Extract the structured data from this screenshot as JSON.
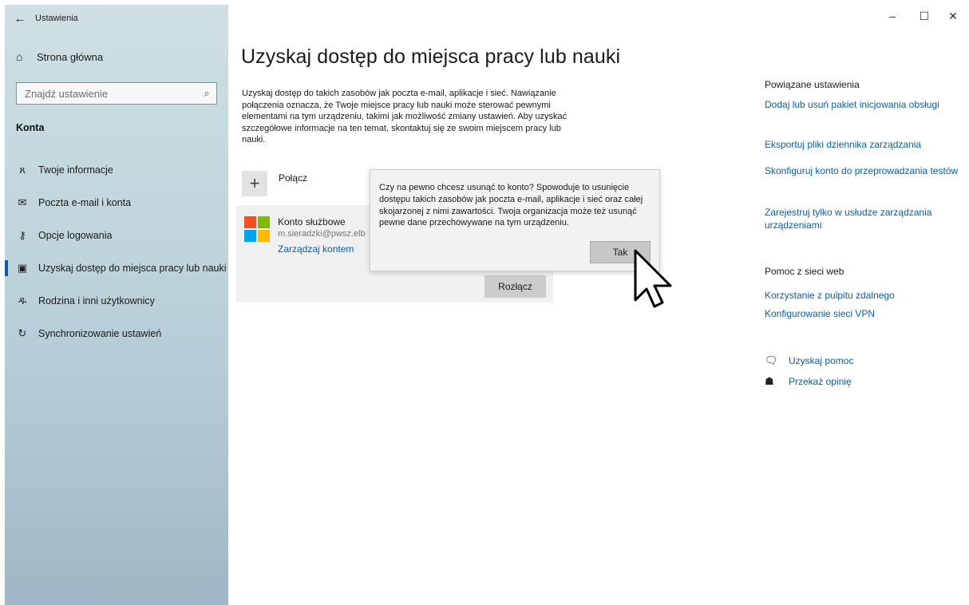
{
  "app": {
    "title": "Ustawienia"
  },
  "window_controls": {
    "minimize": "–",
    "maximize": "☐",
    "close": "✕"
  },
  "sidebar": {
    "home_label": "Strona główna",
    "search_placeholder": "Znajdź ustawienie",
    "section_title": "Konta",
    "items": [
      {
        "label": "Twoje informacje",
        "icon": "person-card-icon"
      },
      {
        "label": "Poczta e-mail i konta",
        "icon": "mail-icon"
      },
      {
        "label": "Opcje logowania",
        "icon": "key-icon"
      },
      {
        "label": "Uzyskaj dostęp do miejsca pracy lub nauki",
        "icon": "briefcase-icon",
        "active": true
      },
      {
        "label": "Rodzina i inni użytkownicy",
        "icon": "add-person-icon"
      },
      {
        "label": "Synchronizowanie ustawień",
        "icon": "sync-icon"
      }
    ]
  },
  "main": {
    "title": "Uzyskaj dostęp do miejsca pracy lub nauki",
    "intro": "Uzyskaj dostęp do takich zasobów jak poczta e-mail, aplikacje i sieć. Nawiązanie połączenia oznacza, że Twoje miejsce pracy lub nauki może sterować pewnymi elementami na tym urządzeniu, takimi jak możliwość zmiany ustawień. Aby uzyskać szczegółowe informacje na ten temat, skontaktuj się ze swoim miejscem pracy lub nauki.",
    "connect_label": "Połącz",
    "account": {
      "name": "Konto służbowe",
      "email": "m.sieradzki@pwsz.elb",
      "manage_label": "Zarządzaj kontem",
      "disconnect_label": "Rozłącz"
    }
  },
  "dialog": {
    "text": "Czy na pewno chcesz usunąć to konto? Spowoduje to usunięcie dostępu takich zasobów jak poczta e-mail, aplikacje i sieć oraz całej skojarzonej z nimi zawartości. Twoja organizacja może też usunąć pewne dane przechowywane na tym urządzeniu.",
    "yes_label": "Tak"
  },
  "right_panel": {
    "related_heading": "Powiązane ustawienia",
    "related_links": [
      "Dodaj lub usuń pakiet inicjowania obsługi",
      "Eksportuj pliki dziennika zarządzania",
      "Skonfiguruj konto do przeprowadzania testów",
      "Zarejestruj tylko w usłudze zarządzania urządzeniami"
    ],
    "web_help_heading": "Pomoc z sieci web",
    "web_help_links": [
      "Korzystanie z pulpitu zdalnego",
      "Konfigurowanie sieci VPN"
    ],
    "get_help_label": "Uzyskaj pomoc",
    "feedback_label": "Przekaż opinię"
  },
  "colors": {
    "accent": "#0a5fa8",
    "ms_red": "#f25022",
    "ms_green": "#7fba00",
    "ms_blue": "#00a4ef",
    "ms_yellow": "#ffb900"
  }
}
